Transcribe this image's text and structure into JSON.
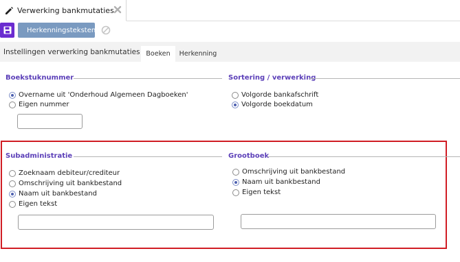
{
  "top_tab": {
    "label": "Verwerking bankmutaties"
  },
  "toolbar": {
    "herkenning_label": "Herkenningsteksten"
  },
  "band": {
    "title": "Instellingen verwerking bankmutaties",
    "tabs": [
      {
        "label": "Boeken"
      },
      {
        "label": "Herkenning"
      }
    ]
  },
  "boekstuknummer": {
    "title": "Boekstuknummer",
    "options": [
      {
        "label": "Overname uit 'Onderhoud Algemeen Dagboeken'",
        "checked": true
      },
      {
        "label": "Eigen nummer",
        "checked": false
      }
    ],
    "input_value": ""
  },
  "sortering": {
    "title": "Sortering / verwerking",
    "options": [
      {
        "label": "Volgorde bankafschrift",
        "checked": false
      },
      {
        "label": "Volgorde boekdatum",
        "checked": true
      }
    ]
  },
  "subadministratie": {
    "title": "Subadministratie",
    "options": [
      {
        "label": "Zoeknaam debiteur/crediteur",
        "checked": false
      },
      {
        "label": "Omschrijving uit bankbestand",
        "checked": false
      },
      {
        "label": "Naam uit bankbestand",
        "checked": true
      },
      {
        "label": "Eigen tekst",
        "checked": false
      }
    ],
    "input_value": ""
  },
  "grootboek": {
    "title": "Grootboek",
    "options": [
      {
        "label": "Omschrijving uit bankbestand",
        "checked": false
      },
      {
        "label": "Naam uit bankbestand",
        "checked": true
      },
      {
        "label": "Eigen tekst",
        "checked": false
      }
    ],
    "input_value": ""
  },
  "colors": {
    "accent": "#6a2cd0",
    "section_title": "#5b3fb8",
    "highlight_border": "#d01c23",
    "secondary_button": "#7a9ac0"
  }
}
